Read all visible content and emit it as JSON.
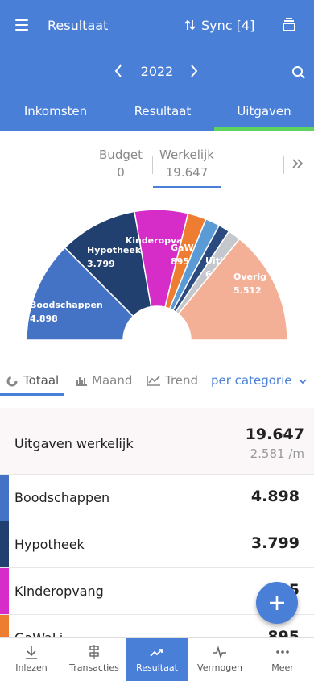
{
  "header": {
    "app_title": "Resultaat",
    "sync_label": "Sync [4]",
    "year": "2022",
    "tabs": [
      {
        "label": "Inkomsten"
      },
      {
        "label": "Resultaat"
      },
      {
        "label": "Uitgaven"
      }
    ]
  },
  "budget_toggle": {
    "budget_label": "Budget",
    "budget_value": "0",
    "actual_label": "Werkelijk",
    "actual_value": "19.647"
  },
  "chart_data": {
    "type": "pie",
    "style": "half-donut",
    "slices": [
      {
        "label": "Boodschappen",
        "value": 4898,
        "value_text": "4.898",
        "color": "#4472c4"
      },
      {
        "label": "Hypotheek",
        "value": 3799,
        "value_text": "3.799",
        "color": "#22406f"
      },
      {
        "label": "Kinderopvang",
        "value": 2581,
        "value_text": "",
        "color": "#d62cc8"
      },
      {
        "label": "GaWaLi",
        "value": 895,
        "value_text": "895",
        "color": "#ee7d31"
      },
      {
        "label": "",
        "value": 700,
        "value_text": "",
        "color": "#5b9bd5"
      },
      {
        "label": "",
        "value": 550,
        "value_text": "",
        "color": "#2a4a80"
      },
      {
        "label": "Uitjes",
        "value": 624,
        "value_text": "624",
        "color": "#c4c7cb"
      },
      {
        "label": "Overig",
        "value": 5512,
        "value_text": "5.512",
        "color": "#f4b096"
      }
    ]
  },
  "view_tabs": {
    "totaal": "Totaal",
    "maand": "Maand",
    "trend": "Trend",
    "per_categorie": "per categorie"
  },
  "summary": {
    "label": "Uitgaven werkelijk",
    "value": "19.647",
    "per_month": "2.581 /m"
  },
  "categories": [
    {
      "label": "Boodschappen",
      "value": "4.898",
      "color": "#4472c4"
    },
    {
      "label": "Hypotheek",
      "value": "3.799",
      "color": "#22406f"
    },
    {
      "label": "Kinderopvang",
      "value": "2.5",
      "color": "#d62cc8"
    },
    {
      "label": "GaWaLi",
      "value": "895",
      "color": "#ee7d31"
    }
  ],
  "bottom_nav": [
    {
      "label": "Inlezen"
    },
    {
      "label": "Transacties"
    },
    {
      "label": "Resultaat"
    },
    {
      "label": "Vermogen"
    },
    {
      "label": "Meer"
    }
  ]
}
